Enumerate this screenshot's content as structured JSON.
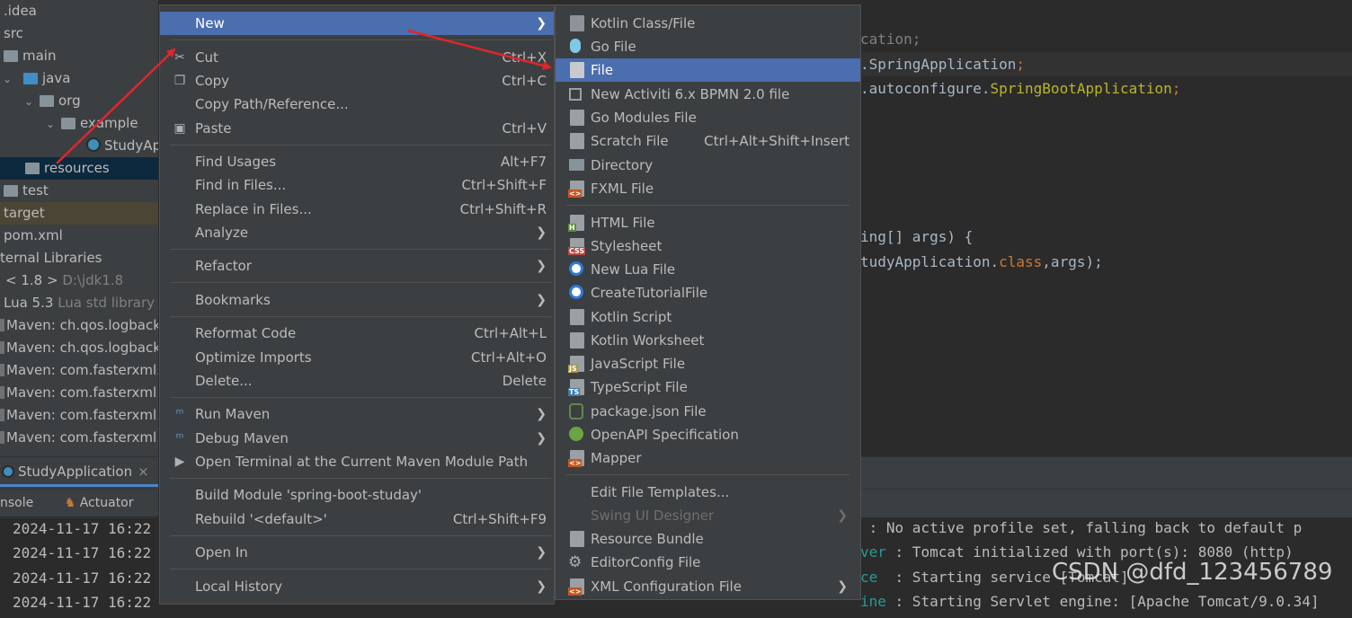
{
  "tree": {
    "items": [
      {
        "label": ".idea",
        "indent": 0,
        "type": "folder"
      },
      {
        "label": "src",
        "indent": 0,
        "type": "folder"
      },
      {
        "label": "main",
        "indent": 1,
        "type": "folder"
      },
      {
        "label": "java",
        "indent": 1,
        "type": "folder-blue"
      },
      {
        "label": "org",
        "indent": 2,
        "type": "package"
      },
      {
        "label": "example",
        "indent": 3,
        "type": "package"
      },
      {
        "label": "StudyAp",
        "indent": 4,
        "type": "class"
      },
      {
        "label": "resources",
        "indent": 1,
        "type": "resources"
      },
      {
        "label": "test",
        "indent": 0,
        "type": "folder"
      },
      {
        "label": "target",
        "indent": 0,
        "type": "folder"
      },
      {
        "label": "pom.xml",
        "indent": 0,
        "type": "file"
      },
      {
        "label": "ternal Libraries",
        "indent": 0,
        "type": "libs"
      },
      {
        "label": "< 1.8 >",
        "dim": "D:\\jdk1.8",
        "indent": 0,
        "type": "lib"
      },
      {
        "label": "Lua 5.3",
        "dim": "Lua std library",
        "indent": 0,
        "type": "lib"
      },
      {
        "label": "Maven: ch.qos.logback:",
        "indent": 0,
        "type": "lib"
      },
      {
        "label": "Maven: ch.qos.logback:",
        "indent": 0,
        "type": "lib"
      },
      {
        "label": "Maven: com.fasterxml.ja",
        "indent": 0,
        "type": "lib"
      },
      {
        "label": "Maven: com.fasterxml.ja",
        "indent": 0,
        "type": "lib"
      },
      {
        "label": "Maven: com.fasterxml.ja",
        "indent": 0,
        "type": "lib"
      },
      {
        "label": "Maven: com.fasterxml.ja",
        "indent": 0,
        "type": "lib"
      }
    ]
  },
  "run_tab": {
    "label": "StudyApplication",
    "close": "×"
  },
  "console_tabs": {
    "console": "nsole",
    "actuator": "Actuator"
  },
  "console_timestamps": [
    "2024-11-17 16:22",
    "2024-11-17 16:22",
    "2024-11-17 16:22",
    "2024-11-17 16:22"
  ],
  "editor": {
    "lines": [
      {
        "parts": [
          {
            "t": "cation;",
            "c": "gray"
          }
        ]
      },
      {
        "parts": [
          {
            "t": ".SpringApplication",
            "c": "text"
          },
          {
            "t": ";",
            "c": "orange"
          }
        ]
      },
      {
        "parts": [
          {
            "t": ".autoconfigure.",
            "c": "text"
          },
          {
            "t": "SpringBootApplication",
            "c": "yellow"
          },
          {
            "t": ";",
            "c": "orange"
          }
        ]
      },
      {
        "parts": [
          {
            "t": "ing[] args) {",
            "c": "text"
          }
        ]
      },
      {
        "parts": [
          {
            "t": "tudyApplication.",
            "c": "text"
          },
          {
            "t": "class",
            "c": "orange"
          },
          {
            "t": ",args);",
            "c": "text"
          }
        ]
      }
    ]
  },
  "console_right": [
    {
      "prefix": "",
      "text": " : No active profile set, falling back to default p"
    },
    {
      "prefix": "ver",
      "text": " : Tomcat initialized with port(s): 8080 (http)"
    },
    {
      "prefix": "ce",
      "text": "  : Starting service [Tomcat]"
    },
    {
      "prefix": "ine",
      "text": " : Starting Servlet engine: [Apache Tomcat/9.0.34]"
    }
  ],
  "menu": {
    "new": {
      "label": "New"
    },
    "cut": {
      "label": "Cut",
      "shortcut": "Ctrl+X"
    },
    "copy": {
      "label": "Copy",
      "shortcut": "Ctrl+C"
    },
    "copy_path": {
      "label": "Copy Path/Reference..."
    },
    "paste": {
      "label": "Paste",
      "shortcut": "Ctrl+V"
    },
    "find_usages": {
      "label": "Find Usages",
      "shortcut": "Alt+F7"
    },
    "find_in_files": {
      "label": "Find in Files...",
      "shortcut": "Ctrl+Shift+F"
    },
    "replace_in_files": {
      "label": "Replace in Files...",
      "shortcut": "Ctrl+Shift+R"
    },
    "analyze": {
      "label": "Analyze"
    },
    "refactor": {
      "label": "Refactor"
    },
    "bookmarks": {
      "label": "Bookmarks"
    },
    "reformat": {
      "label": "Reformat Code",
      "shortcut": "Ctrl+Alt+L"
    },
    "optimize": {
      "label": "Optimize Imports",
      "shortcut": "Ctrl+Alt+O"
    },
    "delete": {
      "label": "Delete...",
      "shortcut": "Delete"
    },
    "run_maven": {
      "label": "Run Maven"
    },
    "debug_maven": {
      "label": "Debug Maven"
    },
    "open_terminal": {
      "label": "Open Terminal at the Current Maven Module Path"
    },
    "build_module": {
      "label": "Build Module 'spring-boot-studay'"
    },
    "rebuild": {
      "label": "Rebuild '<default>'",
      "shortcut": "Ctrl+Shift+F9"
    },
    "open_in": {
      "label": "Open In"
    },
    "local_history": {
      "label": "Local History"
    }
  },
  "submenu": {
    "items": [
      {
        "label": "Kotlin Class/File"
      },
      {
        "label": "Go File"
      },
      {
        "label": "File"
      },
      {
        "label": "New Activiti 6.x BPMN 2.0 file"
      },
      {
        "label": "Go Modules File"
      },
      {
        "label": "Scratch File",
        "shortcut": "Ctrl+Alt+Shift+Insert"
      },
      {
        "label": "Directory"
      },
      {
        "label": "FXML File"
      },
      {
        "label": "HTML File"
      },
      {
        "label": "Stylesheet"
      },
      {
        "label": "New Lua File"
      },
      {
        "label": "CreateTutorialFile"
      },
      {
        "label": "Kotlin Script"
      },
      {
        "label": "Kotlin Worksheet"
      },
      {
        "label": "JavaScript File"
      },
      {
        "label": "TypeScript File"
      },
      {
        "label": "package.json File"
      },
      {
        "label": "OpenAPI Specification"
      },
      {
        "label": "Mapper"
      },
      {
        "label": "Edit File Templates..."
      },
      {
        "label": "Swing UI Designer"
      },
      {
        "label": "Resource Bundle"
      },
      {
        "label": "EditorConfig File"
      },
      {
        "label": "XML Configuration File"
      }
    ]
  },
  "watermark": "CSDN @dfd_123456789",
  "colors": {
    "highlight": "#4b6eaf",
    "menu_bg": "#3c3f41",
    "arrow": "#e0262b"
  }
}
